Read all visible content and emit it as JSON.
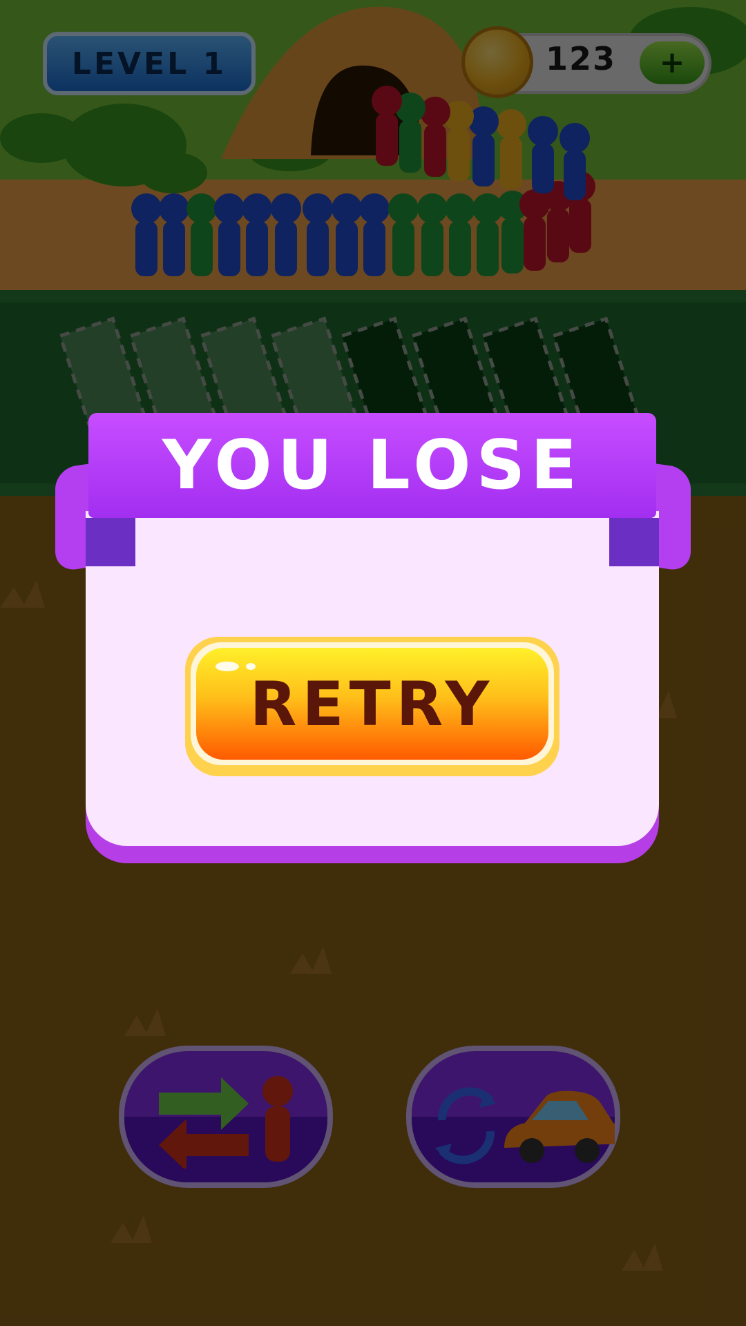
{
  "hud": {
    "level_label": "LEVEL 1",
    "coins": "123",
    "add_label": "+"
  },
  "dialog": {
    "title": "YOU LOSE",
    "retry_label": "RETRY"
  },
  "powerups": [
    {
      "name": "swap-passenger",
      "icon": "swap-arrows-person-icon"
    },
    {
      "name": "shuffle-car",
      "icon": "refresh-car-icon"
    }
  ],
  "slots": {
    "total": 8,
    "filled": 4
  },
  "colors": {
    "ribbon": "#b33ff0",
    "panel": "#fbe6ff",
    "retry_top": "#fff02a",
    "retry_bottom": "#ff5a00",
    "crowd_blue": "#1f4fd6",
    "crowd_green": "#1f9a3c",
    "crowd_red": "#c6162a",
    "crowd_yellow": "#f2b21e"
  }
}
